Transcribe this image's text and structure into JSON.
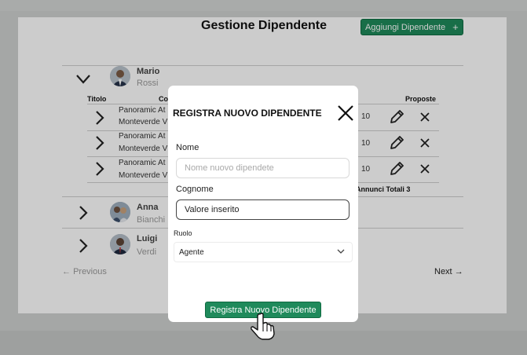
{
  "page": {
    "title": "Gestione Dipendente",
    "add_button": "Aggiungi Dipendente",
    "add_icon": "+"
  },
  "employees": [
    {
      "name": "Mario",
      "surname": "Rossi"
    },
    {
      "name": "Anna",
      "surname": "Bianchi"
    },
    {
      "name": "Luigi",
      "surname": "Verdi"
    }
  ],
  "table": {
    "headers": {
      "titolo": "Titolo",
      "col2": "Co",
      "proposte": "Proposte"
    },
    "rows": [
      {
        "line1": "Panoramic At",
        "line2": "Monteverde V",
        "value": "10"
      },
      {
        "line1": "Panoramic At",
        "line2": "Monteverde V",
        "value": "10"
      },
      {
        "line1": "Panoramic At",
        "line2": "Monteverde V",
        "value": "10"
      }
    ],
    "total": "Annunci Totali 3"
  },
  "pagination": {
    "previous": "Previous",
    "next": "Next"
  },
  "modal": {
    "title": "REGISTRA NUOVO DIPENDENTE",
    "nome_label": "Nome",
    "nome_placeholder": "Nome nuovo dipendete",
    "nome_value": "",
    "cognome_label": "Cognome",
    "cognome_value": "Valore inserito",
    "ruolo_label": "Ruolo",
    "ruolo_value": "Agente",
    "submit": "Registra Nuovo Dipendente"
  },
  "colors": {
    "accent": "#1f8a5b",
    "accent_border": "#0f6b42"
  },
  "icons": [
    "chevron-down-icon",
    "chevron-right-icon",
    "pencil-icon",
    "x-icon",
    "close-icon",
    "arrow-left-icon",
    "arrow-right-icon",
    "hand-pointer-icon"
  ]
}
